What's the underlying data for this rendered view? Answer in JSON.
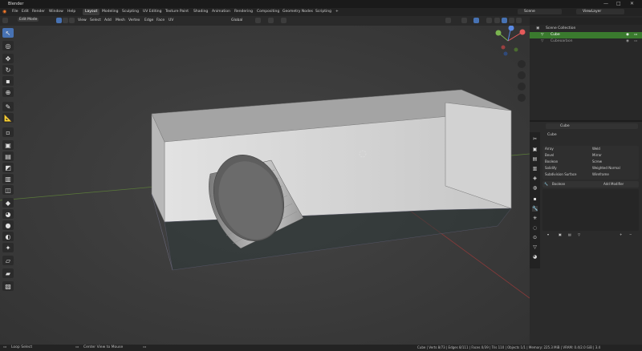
{
  "app": {
    "title": "Blender"
  },
  "menus": [
    "File",
    "Edit",
    "Render",
    "Window",
    "Help"
  ],
  "workspaces": [
    "Layout",
    "Modeling",
    "Sculpting",
    "UV Editing",
    "Texture Paint",
    "Shading",
    "Animation",
    "Rendering",
    "Compositing",
    "Geometry Nodes",
    "Scripting"
  ],
  "active_workspace": "Layout",
  "scene": {
    "name": "Scene"
  },
  "view_layer": {
    "name": "ViewLayer"
  },
  "viewport_header": {
    "mode": "Edit Mode",
    "menus": [
      "View",
      "Select",
      "Add",
      "Mesh",
      "Vertex",
      "Edge",
      "Face",
      "UV"
    ],
    "transform": "Global"
  },
  "outliner": {
    "items": [
      {
        "label": "Scene Collection",
        "selected": false
      },
      {
        "label": "Cube",
        "selected": true
      },
      {
        "label": "Cubeoarbon",
        "selected": false
      }
    ]
  },
  "properties": {
    "object_name": "Cube",
    "modifiers": {
      "left": [
        "Array",
        "Bevel",
        "Boolean",
        "Solidify",
        "Subdivision Surface"
      ],
      "right": [
        "Weld",
        "Mirror",
        "Screw",
        "Weighted Normal",
        "Wireframe"
      ]
    },
    "modifier_header": "Boolean",
    "add_modifier": "Add Modifier"
  },
  "status": {
    "left": "Loop Select",
    "middle": "Center View to Mouse",
    "right": "Cube | Verts 8/73 | Edges 8/111 | Faces 0/39 | Tris 110 | Objects 1/1 | Memory: 225.3 MiB | VRAM: 0.4/2.0 GiB | 3.4"
  }
}
